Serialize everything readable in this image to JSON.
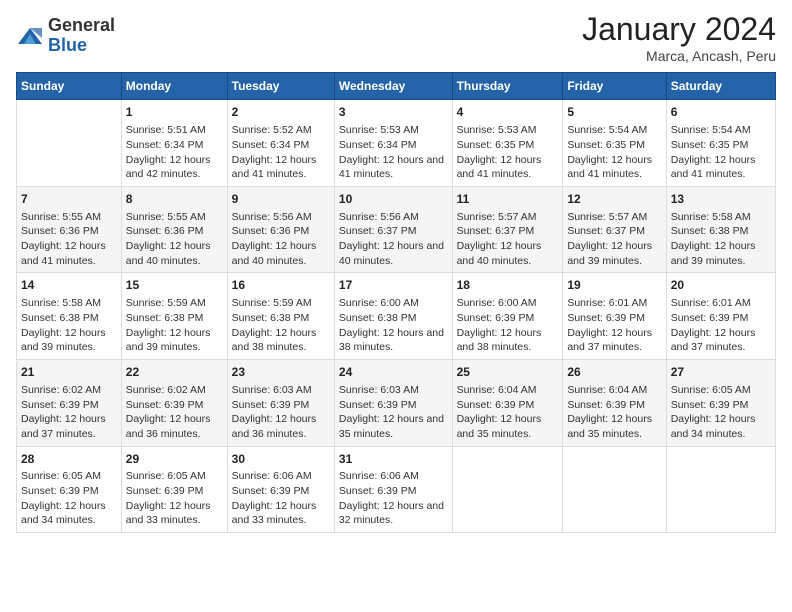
{
  "logo": {
    "general": "General",
    "blue": "Blue"
  },
  "title": "January 2024",
  "subtitle": "Marca, Ancash, Peru",
  "header_days": [
    "Sunday",
    "Monday",
    "Tuesday",
    "Wednesday",
    "Thursday",
    "Friday",
    "Saturday"
  ],
  "weeks": [
    [
      {
        "day": "",
        "sunrise": "",
        "sunset": "",
        "daylight": ""
      },
      {
        "day": "1",
        "sunrise": "Sunrise: 5:51 AM",
        "sunset": "Sunset: 6:34 PM",
        "daylight": "Daylight: 12 hours and 42 minutes."
      },
      {
        "day": "2",
        "sunrise": "Sunrise: 5:52 AM",
        "sunset": "Sunset: 6:34 PM",
        "daylight": "Daylight: 12 hours and 41 minutes."
      },
      {
        "day": "3",
        "sunrise": "Sunrise: 5:53 AM",
        "sunset": "Sunset: 6:34 PM",
        "daylight": "Daylight: 12 hours and 41 minutes."
      },
      {
        "day": "4",
        "sunrise": "Sunrise: 5:53 AM",
        "sunset": "Sunset: 6:35 PM",
        "daylight": "Daylight: 12 hours and 41 minutes."
      },
      {
        "day": "5",
        "sunrise": "Sunrise: 5:54 AM",
        "sunset": "Sunset: 6:35 PM",
        "daylight": "Daylight: 12 hours and 41 minutes."
      },
      {
        "day": "6",
        "sunrise": "Sunrise: 5:54 AM",
        "sunset": "Sunset: 6:35 PM",
        "daylight": "Daylight: 12 hours and 41 minutes."
      }
    ],
    [
      {
        "day": "7",
        "sunrise": "Sunrise: 5:55 AM",
        "sunset": "Sunset: 6:36 PM",
        "daylight": "Daylight: 12 hours and 41 minutes."
      },
      {
        "day": "8",
        "sunrise": "Sunrise: 5:55 AM",
        "sunset": "Sunset: 6:36 PM",
        "daylight": "Daylight: 12 hours and 40 minutes."
      },
      {
        "day": "9",
        "sunrise": "Sunrise: 5:56 AM",
        "sunset": "Sunset: 6:36 PM",
        "daylight": "Daylight: 12 hours and 40 minutes."
      },
      {
        "day": "10",
        "sunrise": "Sunrise: 5:56 AM",
        "sunset": "Sunset: 6:37 PM",
        "daylight": "Daylight: 12 hours and 40 minutes."
      },
      {
        "day": "11",
        "sunrise": "Sunrise: 5:57 AM",
        "sunset": "Sunset: 6:37 PM",
        "daylight": "Daylight: 12 hours and 40 minutes."
      },
      {
        "day": "12",
        "sunrise": "Sunrise: 5:57 AM",
        "sunset": "Sunset: 6:37 PM",
        "daylight": "Daylight: 12 hours and 39 minutes."
      },
      {
        "day": "13",
        "sunrise": "Sunrise: 5:58 AM",
        "sunset": "Sunset: 6:38 PM",
        "daylight": "Daylight: 12 hours and 39 minutes."
      }
    ],
    [
      {
        "day": "14",
        "sunrise": "Sunrise: 5:58 AM",
        "sunset": "Sunset: 6:38 PM",
        "daylight": "Daylight: 12 hours and 39 minutes."
      },
      {
        "day": "15",
        "sunrise": "Sunrise: 5:59 AM",
        "sunset": "Sunset: 6:38 PM",
        "daylight": "Daylight: 12 hours and 39 minutes."
      },
      {
        "day": "16",
        "sunrise": "Sunrise: 5:59 AM",
        "sunset": "Sunset: 6:38 PM",
        "daylight": "Daylight: 12 hours and 38 minutes."
      },
      {
        "day": "17",
        "sunrise": "Sunrise: 6:00 AM",
        "sunset": "Sunset: 6:38 PM",
        "daylight": "Daylight: 12 hours and 38 minutes."
      },
      {
        "day": "18",
        "sunrise": "Sunrise: 6:00 AM",
        "sunset": "Sunset: 6:39 PM",
        "daylight": "Daylight: 12 hours and 38 minutes."
      },
      {
        "day": "19",
        "sunrise": "Sunrise: 6:01 AM",
        "sunset": "Sunset: 6:39 PM",
        "daylight": "Daylight: 12 hours and 37 minutes."
      },
      {
        "day": "20",
        "sunrise": "Sunrise: 6:01 AM",
        "sunset": "Sunset: 6:39 PM",
        "daylight": "Daylight: 12 hours and 37 minutes."
      }
    ],
    [
      {
        "day": "21",
        "sunrise": "Sunrise: 6:02 AM",
        "sunset": "Sunset: 6:39 PM",
        "daylight": "Daylight: 12 hours and 37 minutes."
      },
      {
        "day": "22",
        "sunrise": "Sunrise: 6:02 AM",
        "sunset": "Sunset: 6:39 PM",
        "daylight": "Daylight: 12 hours and 36 minutes."
      },
      {
        "day": "23",
        "sunrise": "Sunrise: 6:03 AM",
        "sunset": "Sunset: 6:39 PM",
        "daylight": "Daylight: 12 hours and 36 minutes."
      },
      {
        "day": "24",
        "sunrise": "Sunrise: 6:03 AM",
        "sunset": "Sunset: 6:39 PM",
        "daylight": "Daylight: 12 hours and 35 minutes."
      },
      {
        "day": "25",
        "sunrise": "Sunrise: 6:04 AM",
        "sunset": "Sunset: 6:39 PM",
        "daylight": "Daylight: 12 hours and 35 minutes."
      },
      {
        "day": "26",
        "sunrise": "Sunrise: 6:04 AM",
        "sunset": "Sunset: 6:39 PM",
        "daylight": "Daylight: 12 hours and 35 minutes."
      },
      {
        "day": "27",
        "sunrise": "Sunrise: 6:05 AM",
        "sunset": "Sunset: 6:39 PM",
        "daylight": "Daylight: 12 hours and 34 minutes."
      }
    ],
    [
      {
        "day": "28",
        "sunrise": "Sunrise: 6:05 AM",
        "sunset": "Sunset: 6:39 PM",
        "daylight": "Daylight: 12 hours and 34 minutes."
      },
      {
        "day": "29",
        "sunrise": "Sunrise: 6:05 AM",
        "sunset": "Sunset: 6:39 PM",
        "daylight": "Daylight: 12 hours and 33 minutes."
      },
      {
        "day": "30",
        "sunrise": "Sunrise: 6:06 AM",
        "sunset": "Sunset: 6:39 PM",
        "daylight": "Daylight: 12 hours and 33 minutes."
      },
      {
        "day": "31",
        "sunrise": "Sunrise: 6:06 AM",
        "sunset": "Sunset: 6:39 PM",
        "daylight": "Daylight: 12 hours and 32 minutes."
      },
      {
        "day": "",
        "sunrise": "",
        "sunset": "",
        "daylight": ""
      },
      {
        "day": "",
        "sunrise": "",
        "sunset": "",
        "daylight": ""
      },
      {
        "day": "",
        "sunrise": "",
        "sunset": "",
        "daylight": ""
      }
    ]
  ]
}
